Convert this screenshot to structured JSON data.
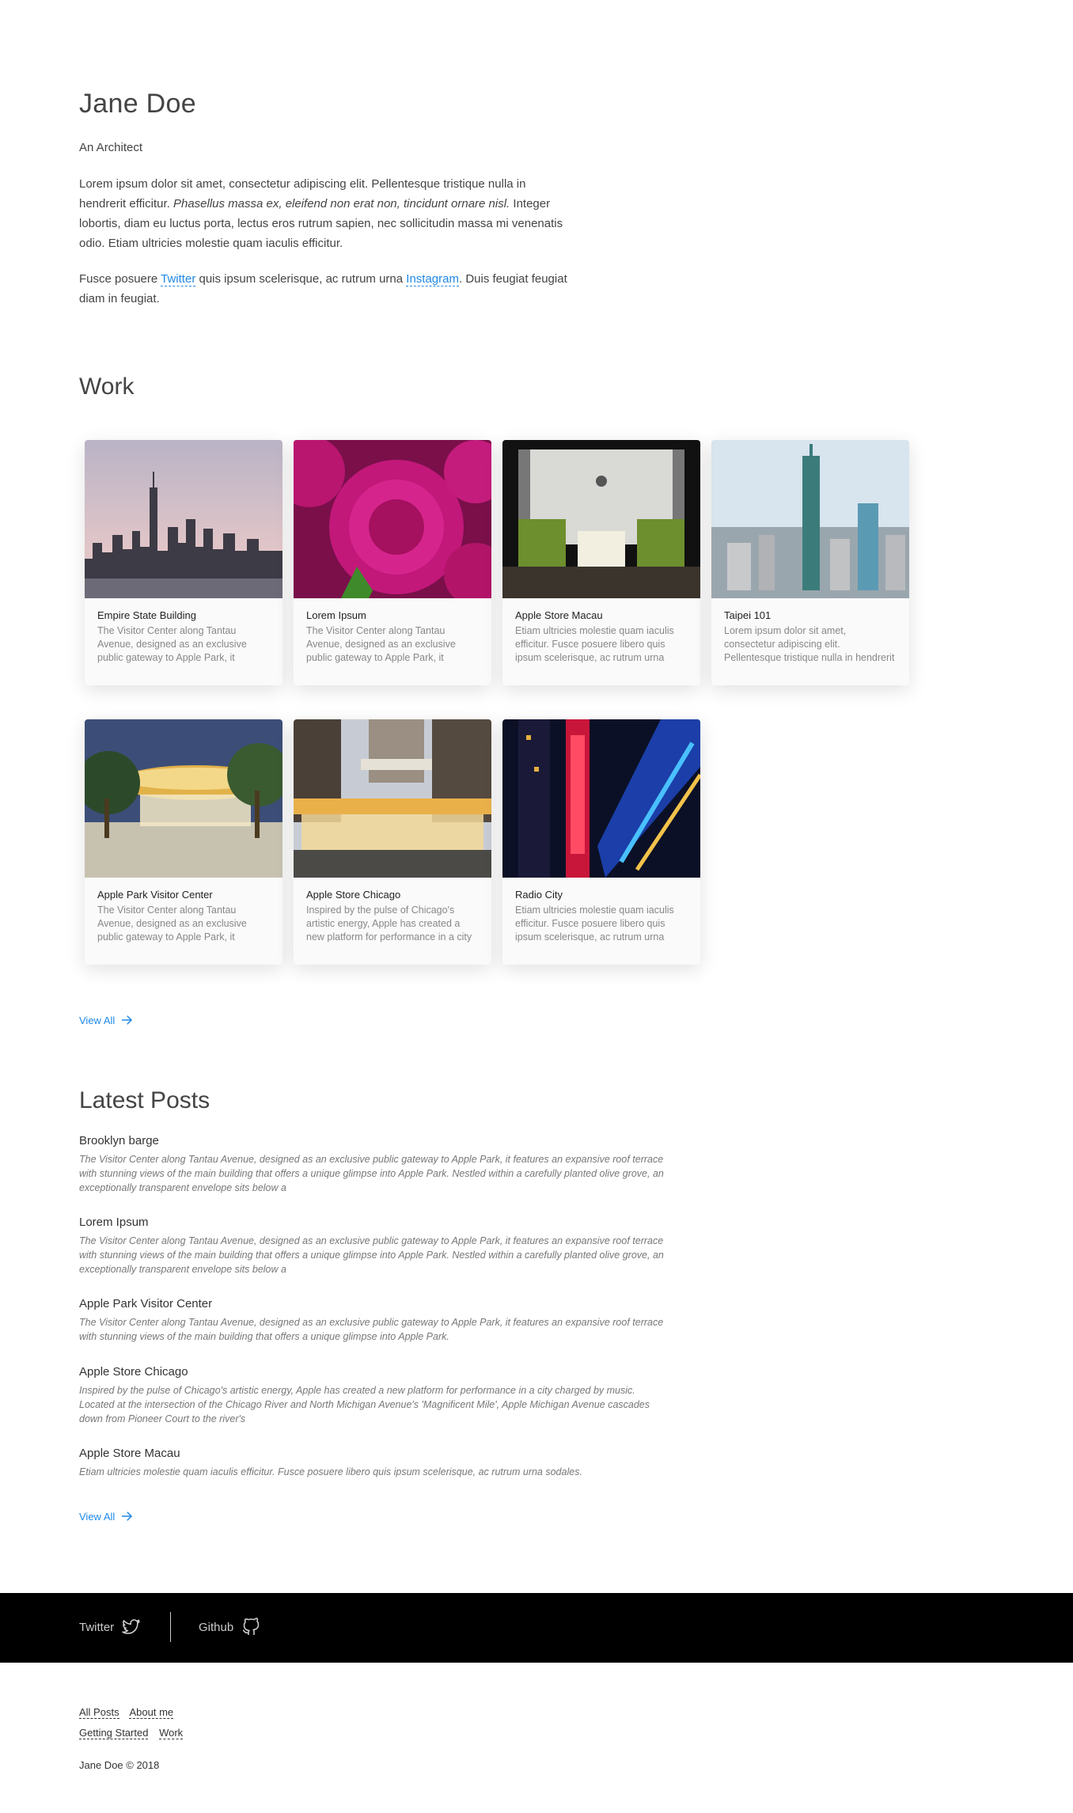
{
  "profile": {
    "name": "Jane Doe",
    "tagline": "An Architect",
    "bio_1": "Lorem ipsum dolor sit amet, consectetur adipiscing elit. Pellentesque tristique nulla in hendrerit efficitur.",
    "bio_1_italic": "Phasellus massa ex, eleifend non erat non, tincidunt ornare nisl.",
    "bio_1_end": "Integer lobortis, diam eu luctus porta, lectus eros rutrum sapien, nec sollicitudin massa mi venenatis odio. Etiam ultricies molestie quam iaculis efficitur.",
    "bio_2_start": "Fusce posuere",
    "bio_2_link1": "Twitter",
    "bio_2_mid": "quis ipsum scelerisque, ac rutrum urna",
    "bio_2_link2": "Instagram",
    "bio_2_end": ". Duis feugiat feugiat diam in feugiat."
  },
  "work": {
    "title": "Work",
    "view_all": "View All",
    "cards": [
      {
        "title": "Empire State Building",
        "desc": "The Visitor Center along Tantau Avenue, designed as an exclusive public gateway to Apple Park, it features"
      },
      {
        "title": "Lorem Ipsum",
        "desc": "The Visitor Center along Tantau Avenue, designed as an exclusive public gateway to Apple Park, it features"
      },
      {
        "title": "Apple Store Macau",
        "desc": "Etiam ultricies molestie quam iaculis efficitur. Fusce posuere libero quis ipsum scelerisque, ac rutrum urna"
      },
      {
        "title": "Taipei 101",
        "desc": "Lorem ipsum dolor sit amet, consectetur adipiscing elit. Pellentesque tristique nulla in hendrerit efficitur. Phasellus"
      },
      {
        "title": "Apple Park Visitor Center",
        "desc": "The Visitor Center along Tantau Avenue, designed as an exclusive public gateway to Apple Park, it features"
      },
      {
        "title": "Apple Store Chicago",
        "desc": "Inspired by the pulse of Chicago's artistic energy, Apple has created a new platform for performance in a city charged"
      },
      {
        "title": "Radio City",
        "desc": "Etiam ultricies molestie quam iaculis efficitur. Fusce posuere libero quis ipsum scelerisque, ac rutrum urna"
      }
    ]
  },
  "posts": {
    "title": "Latest Posts",
    "view_all": "View All",
    "items": [
      {
        "title": "Brooklyn barge",
        "desc": "The Visitor Center along Tantau Avenue, designed as an exclusive public gateway to Apple Park, it features an expansive roof terrace with stunning views of the main building that offers a unique glimpse into Apple Park. Nestled within a carefully planted olive grove, an exceptionally transparent envelope sits below a"
      },
      {
        "title": "Lorem Ipsum",
        "desc": "The Visitor Center along Tantau Avenue, designed as an exclusive public gateway to Apple Park, it features an expansive roof terrace with stunning views of the main building that offers a unique glimpse into Apple Park. Nestled within a carefully planted olive grove, an exceptionally transparent envelope sits below a"
      },
      {
        "title": "Apple Park Visitor Center",
        "desc": "The Visitor Center along Tantau Avenue, designed as an exclusive public gateway to Apple Park, it features an expansive roof terrace with stunning views of the main building that offers a unique glimpse into Apple Park."
      },
      {
        "title": "Apple Store Chicago",
        "desc": "Inspired by the pulse of Chicago's artistic energy, Apple has created a new platform for performance in a city charged by music. Located at the intersection of the Chicago River and North Michigan Avenue's 'Magnificent Mile', Apple Michigan Avenue cascades down from Pioneer Court to the river's"
      },
      {
        "title": "Apple Store Macau",
        "desc": "Etiam ultricies molestie quam iaculis efficitur. Fusce posuere libero quis ipsum scelerisque, ac rutrum urna sodales."
      }
    ]
  },
  "footer": {
    "twitter": "Twitter",
    "github": "Github",
    "links": [
      "All Posts",
      "About me",
      "Getting Started",
      "Work"
    ],
    "copyright": "Jane Doe © 2018"
  },
  "colors": {
    "accent": "#1e88e5",
    "footer_bg": "#000000"
  },
  "icons": {
    "twitter": "twitter-icon",
    "github": "github-icon",
    "arrow": "arrow-right-icon"
  }
}
